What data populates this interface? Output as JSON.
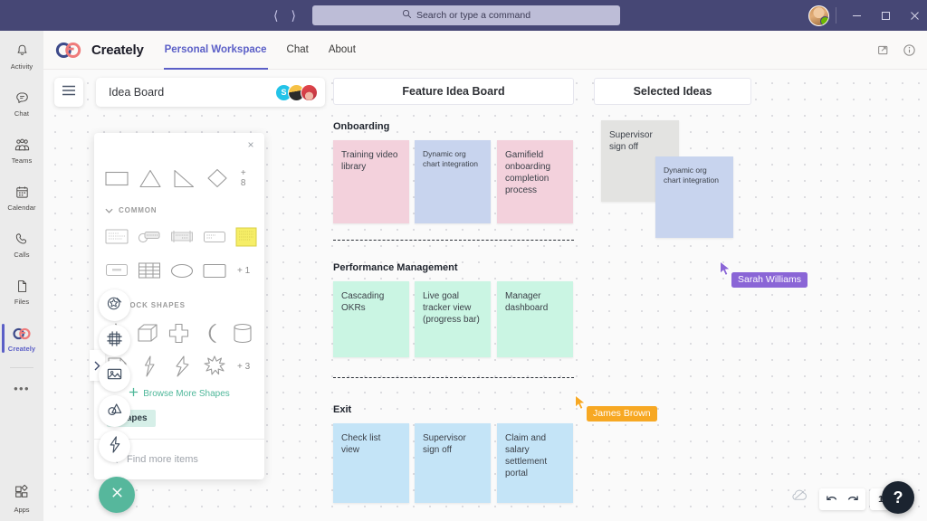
{
  "titlebar": {
    "back_icon": "chevron-left-icon",
    "forward_icon": "chevron-right-icon",
    "search_placeholder": "Search or type a command",
    "search_icon": "search-icon",
    "minimize_label": "–",
    "maximize_label": "□",
    "close_label": "×"
  },
  "rail": {
    "items": [
      {
        "label": "Activity",
        "icon": "bell-icon"
      },
      {
        "label": "Chat",
        "icon": "chat-icon"
      },
      {
        "label": "Teams",
        "icon": "teams-icon"
      },
      {
        "label": "Calendar",
        "icon": "calendar-icon"
      },
      {
        "label": "Calls",
        "icon": "phone-icon"
      },
      {
        "label": "Files",
        "icon": "file-icon"
      },
      {
        "label": "Creately",
        "icon": "creately-logo-icon"
      }
    ],
    "more_label": "•••",
    "apps_label": "Apps"
  },
  "appbar": {
    "brand": "Creately",
    "nav": [
      {
        "label": "Personal Workspace",
        "active": true
      },
      {
        "label": "Chat",
        "active": false
      },
      {
        "label": "About",
        "active": false
      }
    ],
    "popout_icon": "popout-icon",
    "info_icon": "info-icon"
  },
  "board": {
    "hamburger_icon": "hamburger-icon",
    "title": "Idea Board",
    "avatars": [
      {
        "initial": "S",
        "color": "#23c3e8"
      },
      {
        "initial": "",
        "color": "#f6c145"
      },
      {
        "initial": "",
        "color": "#e8484d"
      }
    ],
    "columns": [
      {
        "id": "feature",
        "title": "Feature Idea Board"
      },
      {
        "id": "selected",
        "title": "Selected Ideas"
      }
    ],
    "sections": [
      {
        "label": "Onboarding",
        "notes": [
          {
            "text": "Training video library",
            "color": "#f3d1dc",
            "size": "normal"
          },
          {
            "text": "Dynamic org chart integration",
            "color": "#c8d4ee",
            "size": "small"
          },
          {
            "text": "Gamifield onboarding completion process",
            "color": "#f3d1dc",
            "size": "normal"
          }
        ]
      },
      {
        "label": "Performance Management",
        "notes": [
          {
            "text": "Cascading OKRs",
            "color": "#caf5e3",
            "size": "normal"
          },
          {
            "text": "Live goal tracker view (progress bar)",
            "color": "#caf5e3",
            "size": "normal"
          },
          {
            "text": "Manager dashboard",
            "color": "#caf5e3",
            "size": "normal"
          }
        ]
      },
      {
        "label": "Exit",
        "notes": [
          {
            "text": "Check list view",
            "color": "#c4e4f7",
            "size": "normal"
          },
          {
            "text": "Supervisor sign off",
            "color": "#c4e4f7",
            "size": "normal"
          },
          {
            "text": "Claim and salary settlement portal",
            "color": "#c4e4f7",
            "size": "normal"
          }
        ]
      }
    ],
    "selected_notes": [
      {
        "text": "Supervisor sign off",
        "color": "#e3e3e1",
        "size": "normal"
      },
      {
        "text": "Dynamic org chart integration",
        "color": "#c8d4ee",
        "size": "small"
      }
    ],
    "cursors": [
      {
        "name": "Sarah Williams",
        "color": "#8a65d6"
      },
      {
        "name": "James Brown",
        "color": "#f7a823"
      }
    ]
  },
  "shapes_panel": {
    "close_label": "×",
    "quick_shapes": [
      "rectangle-shape",
      "triangle-shape",
      "right-triangle-shape",
      "diamond-shape"
    ],
    "quick_more": "+ 8",
    "groups": [
      {
        "title": "COMMON",
        "chevron_icon": "chevron-down-icon",
        "rows": [
          {
            "shapes": [
              "note-lines-shape",
              "tag-shape",
              "banner-shape",
              "label-shape",
              "sticky-note-shape"
            ],
            "more": ""
          },
          {
            "shapes": [
              "card-shape",
              "table-shape",
              "ellipse-shape",
              "rounded-rect-shape"
            ],
            "more": "+ 1"
          }
        ]
      },
      {
        "title": "BLOCK SHAPES",
        "chevron_icon": "chevron-down-icon",
        "rows": [
          {
            "shapes": [
              "cone-shape",
              "cube-shape",
              "cross-shape",
              "moon-shape",
              "cylinder-shape"
            ],
            "more": ""
          },
          {
            "shapes": [
              "document-shape",
              "bolt-shape",
              "lightning-shape",
              "star-burst-shape"
            ],
            "more": "+ 3"
          }
        ]
      }
    ],
    "browse_more_label": "Browse More Shapes",
    "browse_more_icon": "plus-icon",
    "active_tag": "Shapes",
    "search_placeholder": "Find more items",
    "search_icon": "search-icon"
  },
  "tools": {
    "expander_icon": "chevron-right-icon",
    "buttons": [
      {
        "icon": "shapes-magic-icon"
      },
      {
        "icon": "frame-icon"
      },
      {
        "icon": "image-icon"
      },
      {
        "icon": "objects-icon"
      },
      {
        "icon": "lightning-icon"
      }
    ],
    "close_icon": "close-icon"
  },
  "footer": {
    "cloud_icon": "cloud-sync-icon",
    "undo_icon": "undo-icon",
    "redo_icon": "redo-icon",
    "zoom_level": "100%",
    "help_label": "?"
  }
}
